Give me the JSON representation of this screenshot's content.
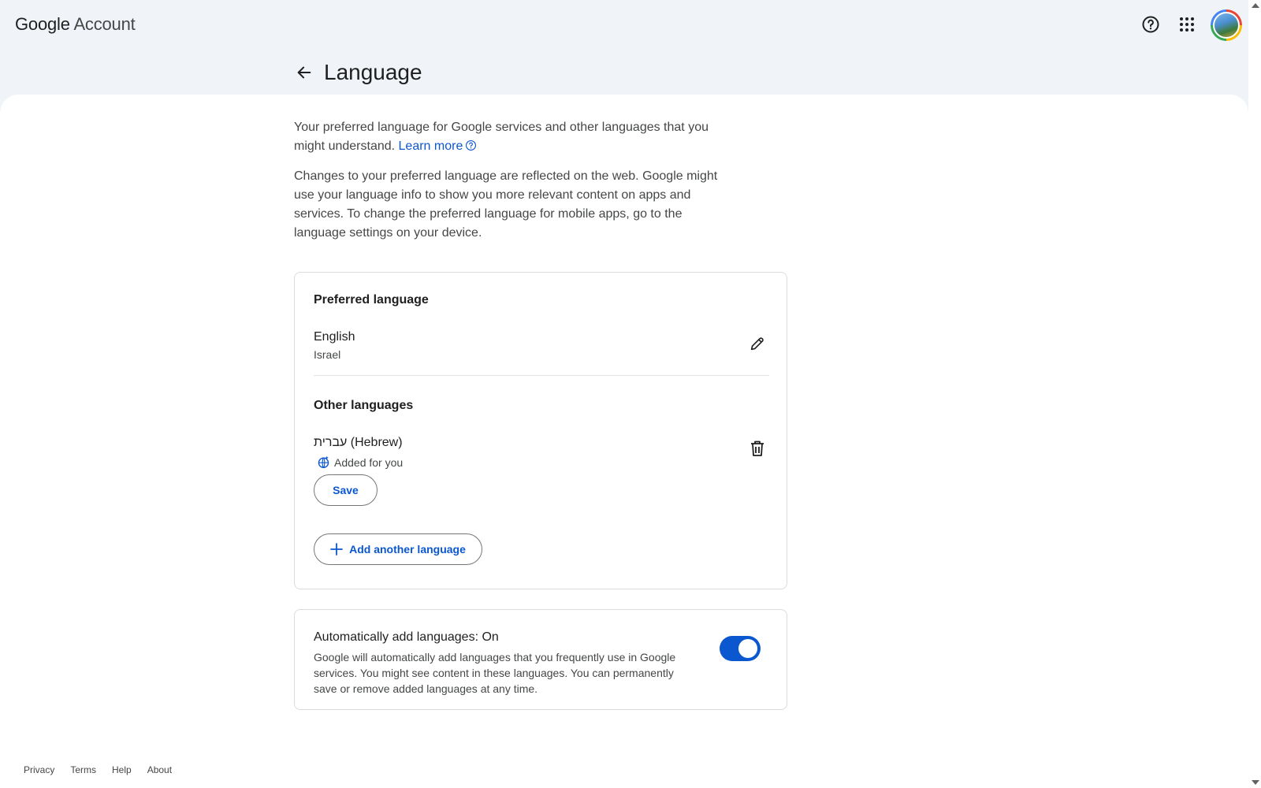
{
  "header": {
    "logo_google": "Google",
    "logo_account": "Account",
    "help_icon": "help-circle-icon",
    "apps_icon": "grid-apps-icon"
  },
  "page": {
    "title": "Language",
    "intro_text": "Your preferred language for Google services and other languages that you might understand.",
    "learn_more": "Learn more",
    "changes_text": "Changes to your preferred language are reflected on the web. Google might use your language info to show you more relevant content on apps and services. To change the preferred language for mobile apps, go to the language settings on your device."
  },
  "preferred": {
    "section_title": "Preferred language",
    "language": "English",
    "region": "Israel"
  },
  "other": {
    "section_title": "Other languages",
    "language": "עברית (Hebrew)",
    "added_label": "Added for you",
    "save_label": "Save",
    "add_label": "Add another language"
  },
  "auto_add": {
    "title": "Automatically add languages: On",
    "description": "Google will automatically add languages that you frequently use in Google services. You might see content in these languages. You can permanently save or remove added languages at any time.",
    "enabled": true
  },
  "footer": {
    "privacy": "Privacy",
    "terms": "Terms",
    "help": "Help",
    "about": "About"
  },
  "colors": {
    "accent": "#0b57d0",
    "background": "#f0f4f9"
  }
}
